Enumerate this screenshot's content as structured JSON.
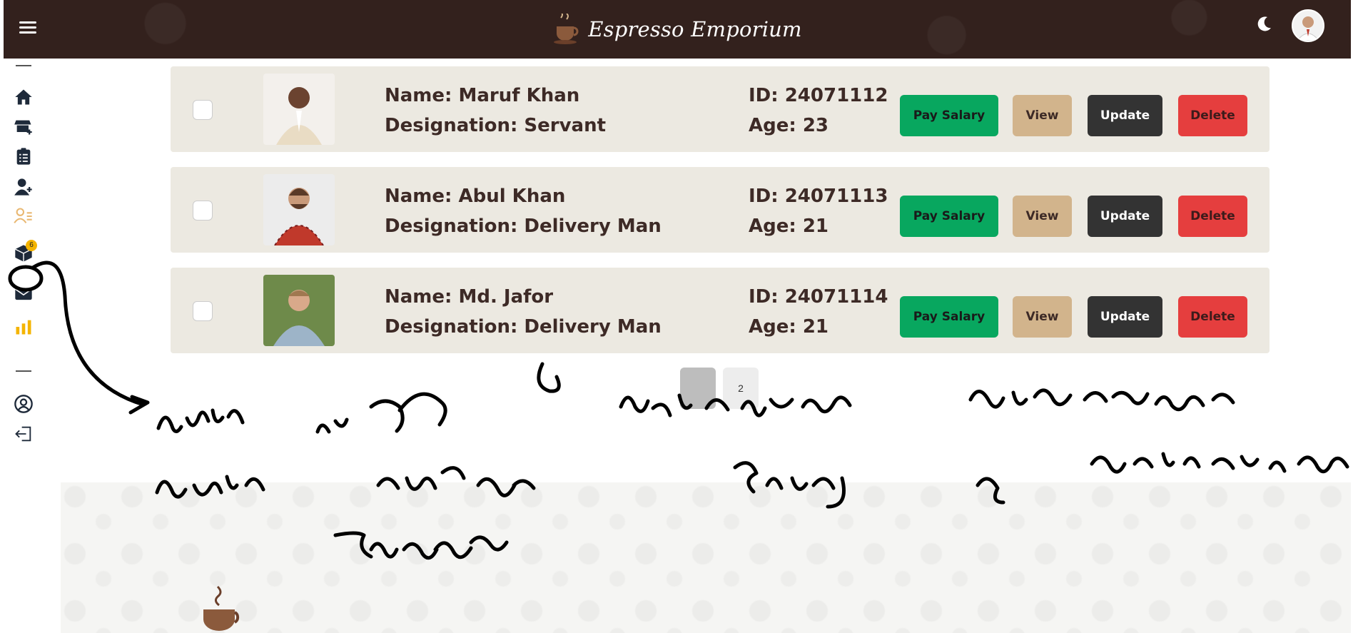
{
  "header": {
    "brand_title": "Espresso Emporium",
    "theme_icon": "moon-icon",
    "menu_icon": "hamburger-icon"
  },
  "sidebar": {
    "items": [
      {
        "icon": "home-icon"
      },
      {
        "icon": "add-store-icon"
      },
      {
        "icon": "clipboard-list-icon"
      },
      {
        "icon": "add-user-icon"
      },
      {
        "icon": "user-list-icon"
      },
      {
        "icon": "box-icon"
      },
      {
        "icon": "envelope-icon"
      },
      {
        "icon": "bar-chart-icon"
      },
      {
        "icon": "user-circle-icon"
      },
      {
        "icon": "logout-icon"
      }
    ],
    "box_badge": "6"
  },
  "employees": [
    {
      "name": "Name: Maruf Khan",
      "designation": "Designation: Servant",
      "id": "ID: 24071112",
      "age": "Age: 23"
    },
    {
      "name": "Name: Abul Khan",
      "designation": "Designation: Delivery Man",
      "id": "ID: 24071113",
      "age": "Age: 21"
    },
    {
      "name": "Name: Md. Jafor",
      "designation": "Designation: Delivery Man",
      "id": "ID: 24071114",
      "age": "Age: 21"
    }
  ],
  "buttons": {
    "pay_salary": "Pay Salary",
    "view": "View",
    "update": "Update",
    "delete": "Delete"
  },
  "pagination": {
    "page2": "2"
  },
  "colors": {
    "header_bg": "#33211d",
    "card_bg": "#ece9e1",
    "pay": "#08a75f",
    "view": "#d2b48c",
    "update": "#333333",
    "delete": "#e53e3e"
  }
}
